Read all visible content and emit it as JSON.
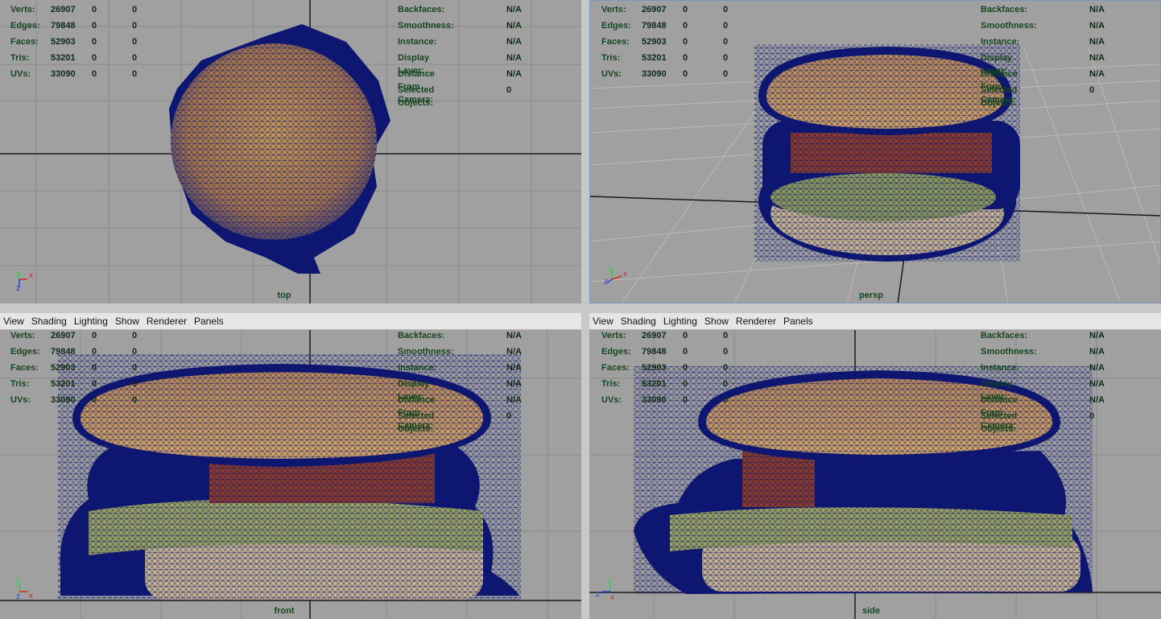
{
  "menu": [
    "View",
    "Shading",
    "Lighting",
    "Show",
    "Renderer",
    "Panels"
  ],
  "stats": [
    {
      "label": "Verts:",
      "v1": "26907",
      "v2": "0",
      "v3": "0"
    },
    {
      "label": "Edges:",
      "v1": "79848",
      "v2": "0",
      "v3": "0"
    },
    {
      "label": "Faces:",
      "v1": "52903",
      "v2": "0",
      "v3": "0"
    },
    {
      "label": "Tris:",
      "v1": "53201",
      "v2": "0",
      "v3": "0"
    },
    {
      "label": "UVs:",
      "v1": "33090",
      "v2": "0",
      "v3": "0"
    }
  ],
  "info": [
    {
      "label": "Backfaces:",
      "value": "N/A"
    },
    {
      "label": "Smoothness:",
      "value": "N/A"
    },
    {
      "label": "Instance:",
      "value": "N/A"
    },
    {
      "label": "Display Layer:",
      "value": "N/A"
    },
    {
      "label": "Distance From Camera:",
      "value": "N/A"
    },
    {
      "label": "Selected Objects:",
      "value": "0"
    }
  ],
  "cameras": {
    "top": "top",
    "persp": "persp",
    "front": "front",
    "side": "side"
  },
  "axis_labels": {
    "x": "x",
    "y": "y",
    "z": "z"
  },
  "colors": {
    "viewport_bg": "#a0a0a0",
    "wire": "#0d1670",
    "hud_text": "#15461f",
    "bun": "#c99a55",
    "patty": "#8b3b2a",
    "lettuce": "#b9c06a"
  }
}
